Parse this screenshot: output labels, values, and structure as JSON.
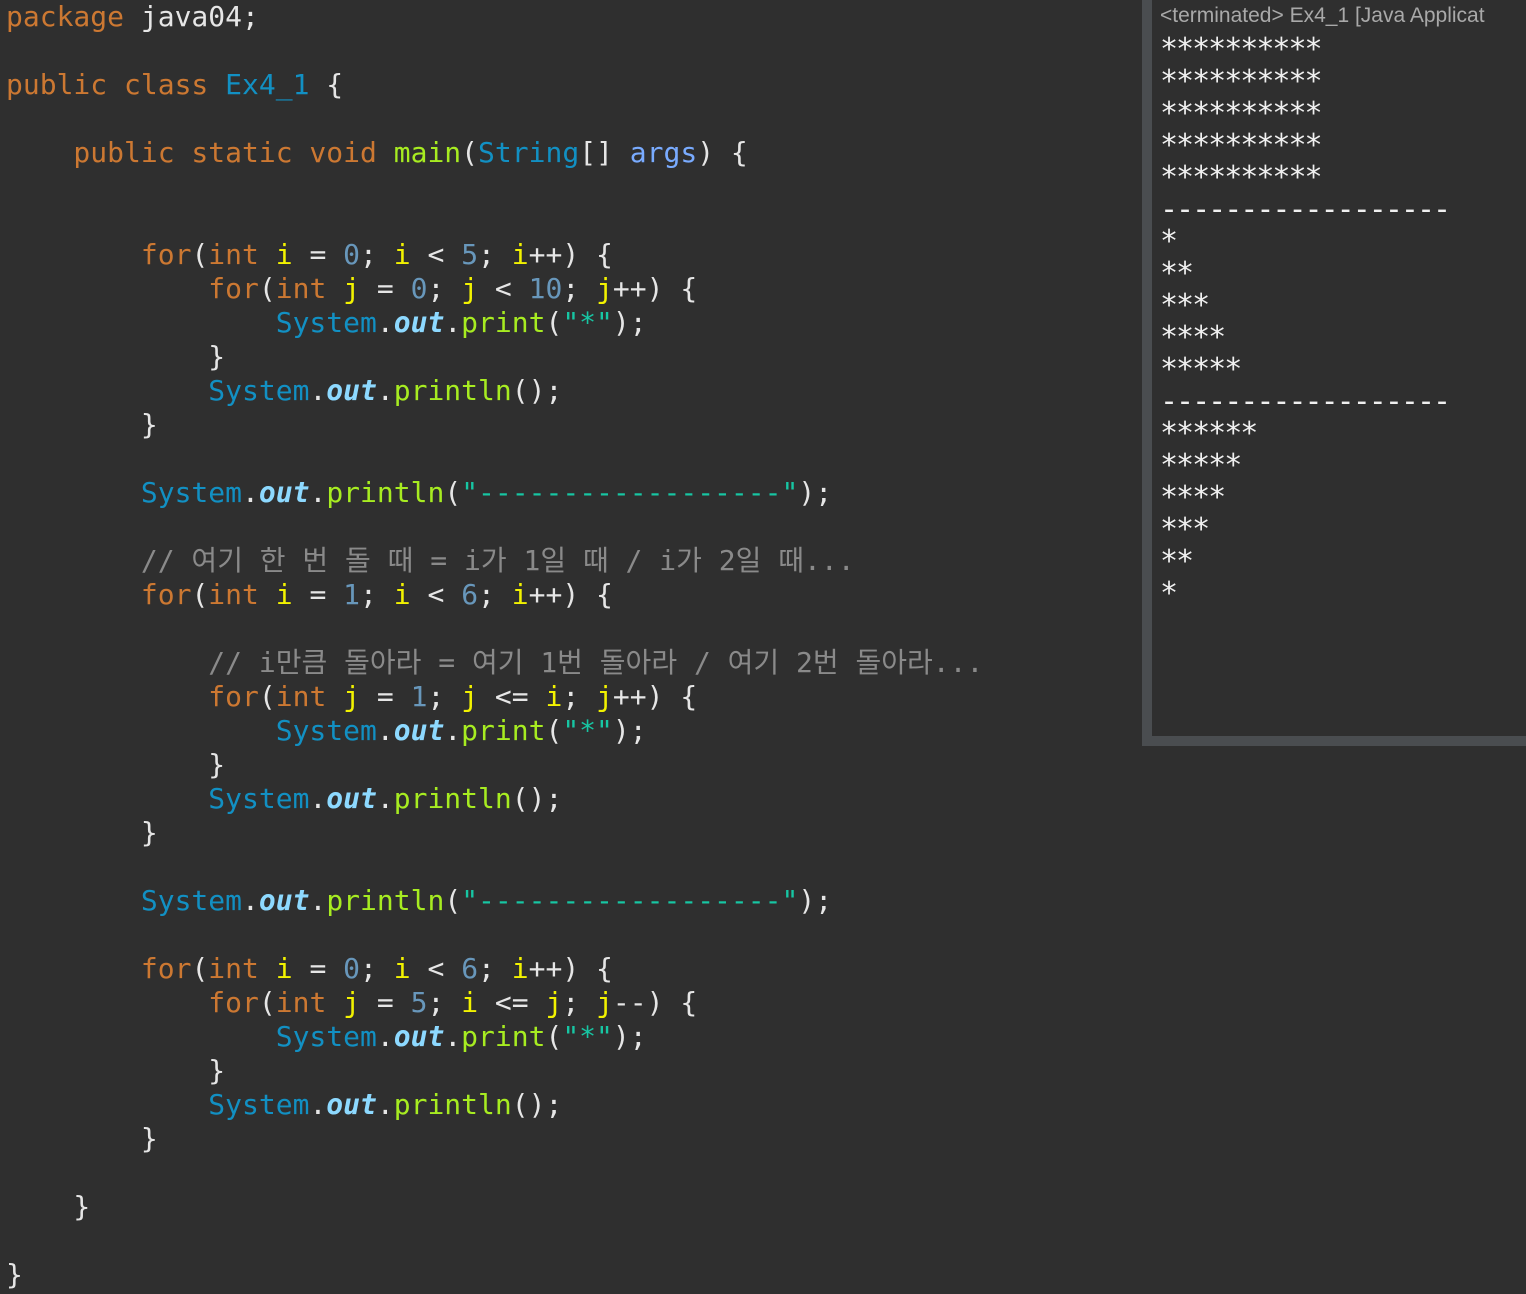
{
  "editor": {
    "lines": [
      [
        {
          "t": "package ",
          "c": "kw"
        },
        {
          "t": "java04;",
          "c": "pl"
        }
      ],
      [
        {
          "t": "public class ",
          "c": "kw"
        },
        {
          "t": "Ex4_1",
          "c": "cls"
        },
        {
          "t": " {",
          "c": "pl"
        }
      ],
      [
        {
          "t": "    public static void ",
          "c": "kw"
        },
        {
          "t": "main",
          "c": "fn"
        },
        {
          "t": "(",
          "c": "pl"
        },
        {
          "t": "String",
          "c": "cls"
        },
        {
          "t": "[] ",
          "c": "pl"
        },
        {
          "t": "args",
          "c": "par"
        },
        {
          "t": ") {",
          "c": "pl"
        }
      ],
      [
        {
          "t": "        for",
          "c": "kw"
        },
        {
          "t": "(",
          "c": "pl"
        },
        {
          "t": "int ",
          "c": "kw"
        },
        {
          "t": "i",
          "c": "var"
        },
        {
          "t": " = ",
          "c": "pl"
        },
        {
          "t": "0",
          "c": "num"
        },
        {
          "t": "; ",
          "c": "pl"
        },
        {
          "t": "i",
          "c": "var"
        },
        {
          "t": " < ",
          "c": "pl"
        },
        {
          "t": "5",
          "c": "num"
        },
        {
          "t": "; ",
          "c": "pl"
        },
        {
          "t": "i",
          "c": "var"
        },
        {
          "t": "++) {",
          "c": "pl"
        }
      ],
      [
        {
          "t": "            for",
          "c": "kw"
        },
        {
          "t": "(",
          "c": "pl"
        },
        {
          "t": "int ",
          "c": "kw"
        },
        {
          "t": "j",
          "c": "var"
        },
        {
          "t": " = ",
          "c": "pl"
        },
        {
          "t": "0",
          "c": "num"
        },
        {
          "t": "; ",
          "c": "pl"
        },
        {
          "t": "j",
          "c": "var"
        },
        {
          "t": " < ",
          "c": "pl"
        },
        {
          "t": "10",
          "c": "num"
        },
        {
          "t": "; ",
          "c": "pl"
        },
        {
          "t": "j",
          "c": "var"
        },
        {
          "t": "++) {",
          "c": "pl"
        }
      ],
      [
        {
          "t": "                System",
          "c": "cls"
        },
        {
          "t": ".",
          "c": "pl"
        },
        {
          "t": "out",
          "c": "fld"
        },
        {
          "t": ".",
          "c": "pl"
        },
        {
          "t": "print",
          "c": "fn"
        },
        {
          "t": "(",
          "c": "pl"
        },
        {
          "t": "\"*\"",
          "c": "str"
        },
        {
          "t": ");",
          "c": "pl"
        }
      ],
      [
        {
          "t": "            }",
          "c": "pl"
        }
      ],
      [
        {
          "t": "            System",
          "c": "cls"
        },
        {
          "t": ".",
          "c": "pl"
        },
        {
          "t": "out",
          "c": "fld"
        },
        {
          "t": ".",
          "c": "pl"
        },
        {
          "t": "println",
          "c": "fn"
        },
        {
          "t": "();",
          "c": "pl"
        }
      ],
      [
        {
          "t": "        }",
          "c": "pl"
        }
      ],
      [
        {
          "t": "        System",
          "c": "cls"
        },
        {
          "t": ".",
          "c": "pl"
        },
        {
          "t": "out",
          "c": "fld"
        },
        {
          "t": ".",
          "c": "pl"
        },
        {
          "t": "println",
          "c": "fn"
        },
        {
          "t": "(",
          "c": "pl"
        },
        {
          "t": "\"------------------\"",
          "c": "str"
        },
        {
          "t": ");",
          "c": "pl"
        }
      ],
      [
        {
          "t": "        // 여기 한 번 돌 때 = i가 1일 때 / i가 2일 때...",
          "c": "cmt"
        }
      ],
      [
        {
          "t": "        for",
          "c": "kw"
        },
        {
          "t": "(",
          "c": "pl"
        },
        {
          "t": "int ",
          "c": "kw"
        },
        {
          "t": "i",
          "c": "var"
        },
        {
          "t": " = ",
          "c": "pl"
        },
        {
          "t": "1",
          "c": "num"
        },
        {
          "t": "; ",
          "c": "pl"
        },
        {
          "t": "i",
          "c": "var"
        },
        {
          "t": " < ",
          "c": "pl"
        },
        {
          "t": "6",
          "c": "num"
        },
        {
          "t": "; ",
          "c": "pl"
        },
        {
          "t": "i",
          "c": "var"
        },
        {
          "t": "++) {",
          "c": "pl"
        }
      ],
      [
        {
          "t": "            // i만큼 돌아라 = 여기 1번 돌아라 / 여기 2번 돌아라...",
          "c": "cmt"
        }
      ],
      [
        {
          "t": "            for",
          "c": "kw"
        },
        {
          "t": "(",
          "c": "pl"
        },
        {
          "t": "int ",
          "c": "kw"
        },
        {
          "t": "j",
          "c": "var"
        },
        {
          "t": " = ",
          "c": "pl"
        },
        {
          "t": "1",
          "c": "num"
        },
        {
          "t": "; ",
          "c": "pl"
        },
        {
          "t": "j",
          "c": "var"
        },
        {
          "t": " <= ",
          "c": "pl"
        },
        {
          "t": "i",
          "c": "var"
        },
        {
          "t": "; ",
          "c": "pl"
        },
        {
          "t": "j",
          "c": "var"
        },
        {
          "t": "++) {",
          "c": "pl"
        }
      ],
      [
        {
          "t": "                System",
          "c": "cls"
        },
        {
          "t": ".",
          "c": "pl"
        },
        {
          "t": "out",
          "c": "fld"
        },
        {
          "t": ".",
          "c": "pl"
        },
        {
          "t": "print",
          "c": "fn"
        },
        {
          "t": "(",
          "c": "pl"
        },
        {
          "t": "\"*\"",
          "c": "str"
        },
        {
          "t": ");",
          "c": "pl"
        }
      ],
      [
        {
          "t": "            }",
          "c": "pl"
        }
      ],
      [
        {
          "t": "            System",
          "c": "cls"
        },
        {
          "t": ".",
          "c": "pl"
        },
        {
          "t": "out",
          "c": "fld"
        },
        {
          "t": ".",
          "c": "pl"
        },
        {
          "t": "println",
          "c": "fn"
        },
        {
          "t": "();",
          "c": "pl"
        }
      ],
      [
        {
          "t": "        }",
          "c": "pl"
        }
      ],
      [
        {
          "t": "        System",
          "c": "cls"
        },
        {
          "t": ".",
          "c": "pl"
        },
        {
          "t": "out",
          "c": "fld"
        },
        {
          "t": ".",
          "c": "pl"
        },
        {
          "t": "println",
          "c": "fn"
        },
        {
          "t": "(",
          "c": "pl"
        },
        {
          "t": "\"------------------\"",
          "c": "str"
        },
        {
          "t": ");",
          "c": "pl"
        }
      ],
      [
        {
          "t": "        for",
          "c": "kw"
        },
        {
          "t": "(",
          "c": "pl"
        },
        {
          "t": "int ",
          "c": "kw"
        },
        {
          "t": "i",
          "c": "var"
        },
        {
          "t": " = ",
          "c": "pl"
        },
        {
          "t": "0",
          "c": "num"
        },
        {
          "t": "; ",
          "c": "pl"
        },
        {
          "t": "i",
          "c": "var"
        },
        {
          "t": " < ",
          "c": "pl"
        },
        {
          "t": "6",
          "c": "num"
        },
        {
          "t": "; ",
          "c": "pl"
        },
        {
          "t": "i",
          "c": "var"
        },
        {
          "t": "++) {",
          "c": "pl"
        }
      ],
      [
        {
          "t": "            for",
          "c": "kw"
        },
        {
          "t": "(",
          "c": "pl"
        },
        {
          "t": "int ",
          "c": "kw"
        },
        {
          "t": "j",
          "c": "var"
        },
        {
          "t": " = ",
          "c": "pl"
        },
        {
          "t": "5",
          "c": "num"
        },
        {
          "t": "; ",
          "c": "pl"
        },
        {
          "t": "i",
          "c": "var"
        },
        {
          "t": " <= ",
          "c": "pl"
        },
        {
          "t": "j",
          "c": "var"
        },
        {
          "t": "; ",
          "c": "pl"
        },
        {
          "t": "j",
          "c": "var"
        },
        {
          "t": "--) {",
          "c": "pl"
        }
      ],
      [
        {
          "t": "                System",
          "c": "cls"
        },
        {
          "t": ".",
          "c": "pl"
        },
        {
          "t": "out",
          "c": "fld"
        },
        {
          "t": ".",
          "c": "pl"
        },
        {
          "t": "print",
          "c": "fn"
        },
        {
          "t": "(",
          "c": "pl"
        },
        {
          "t": "\"*\"",
          "c": "str"
        },
        {
          "t": ");",
          "c": "pl"
        }
      ],
      [
        {
          "t": "            }",
          "c": "pl"
        }
      ],
      [
        {
          "t": "            System",
          "c": "cls"
        },
        {
          "t": ".",
          "c": "pl"
        },
        {
          "t": "out",
          "c": "fld"
        },
        {
          "t": ".",
          "c": "pl"
        },
        {
          "t": "println",
          "c": "fn"
        },
        {
          "t": "();",
          "c": "pl"
        }
      ],
      [
        {
          "t": "        }",
          "c": "pl"
        }
      ],
      [
        {
          "t": "    }",
          "c": "pl"
        }
      ],
      [
        {
          "t": "}",
          "c": "pl"
        }
      ]
    ]
  },
  "console": {
    "header": "<terminated> Ex4_1 [Java Applicat",
    "output": [
      "**********",
      "**********",
      "**********",
      "**********",
      "**********",
      "------------------",
      "*",
      "**",
      "***",
      "****",
      "*****",
      "------------------",
      "******",
      "*****",
      "****",
      "***",
      "**",
      "*"
    ]
  },
  "colors": {
    "background": "#2f2f2f",
    "keyword": "#cc7832",
    "class": "#1290c3",
    "method": "#a7ec21",
    "variable": "#f2f200",
    "number": "#6897bb",
    "string": "#17c6a3",
    "field": "#8dd9ff",
    "comment": "#8a8a8a",
    "parameter": "#79abff"
  }
}
